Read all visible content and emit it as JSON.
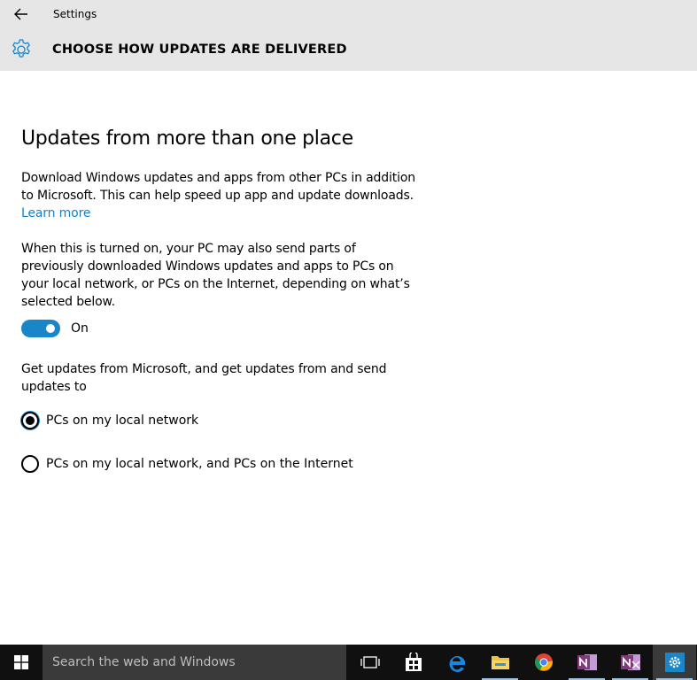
{
  "window": {
    "app_title": "Settings",
    "page_title": "CHOOSE HOW UPDATES ARE DELIVERED"
  },
  "content": {
    "section_title": "Updates from more than one place",
    "description": "Download Windows updates and apps from other PCs in addition to Microsoft. This can help speed up app and update downloads.",
    "learn_more": "Learn more",
    "when_on_text": "When this is turned on, your PC may also send parts of previously downloaded Windows updates and apps to PCs on your local network, or PCs on the Internet, depending on what’s selected below.",
    "toggle": {
      "label": "On",
      "state": true
    },
    "options_intro": "Get updates from Microsoft, and get updates from and send updates to",
    "options": [
      {
        "label": "PCs on my local network",
        "selected": true
      },
      {
        "label": "PCs on my local network, and PCs on the Internet",
        "selected": false
      }
    ]
  },
  "taskbar": {
    "search_placeholder": "Search the web and Windows",
    "icons": [
      "windows-start-icon",
      "task-view-icon",
      "store-icon",
      "edge-icon",
      "file-explorer-icon",
      "chrome-icon",
      "onenote-icon",
      "onenote-clipper-icon",
      "settings-icon"
    ]
  },
  "colors": {
    "accent": "#1a86c8",
    "link": "#1a7fc1",
    "header_bg": "#e6e6e6",
    "taskbar_bg": "#101010"
  }
}
